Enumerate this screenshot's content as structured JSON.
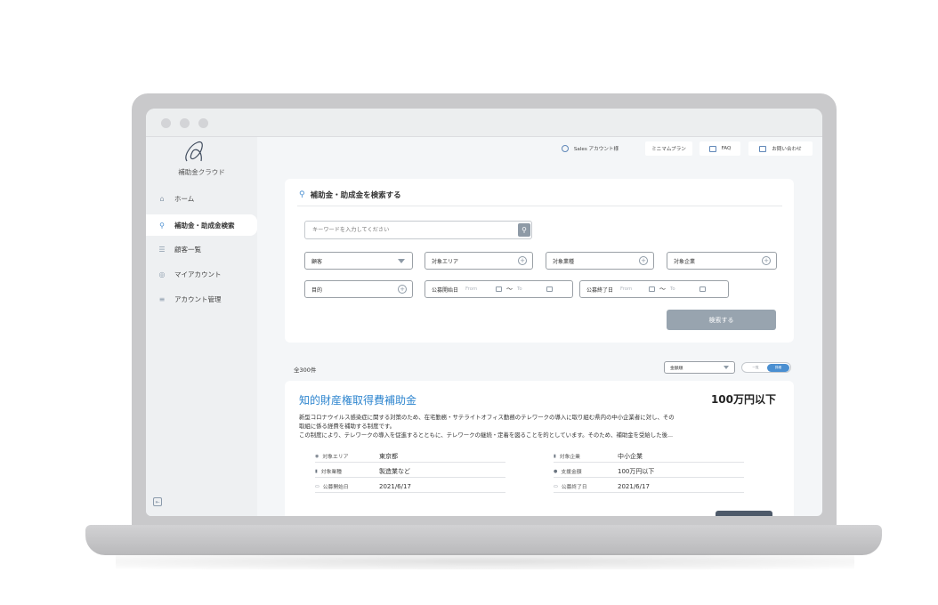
{
  "app": {
    "logo_text": "補助金クラウド"
  },
  "sidebar": {
    "items": [
      {
        "label": "ホーム",
        "icon": "home-icon"
      },
      {
        "label": "補助金・助成金検索",
        "icon": "search-icon",
        "active": true
      },
      {
        "label": "顧客一覧",
        "icon": "user-list-icon"
      },
      {
        "label": "マイアカウント",
        "icon": "user-circle-icon"
      },
      {
        "label": "アカウント管理",
        "icon": "settings-list-icon"
      }
    ]
  },
  "header": {
    "user_label": "Sales アカウント様",
    "plan_label": "ミニマムプラン",
    "faq_label": "FAQ",
    "contact_label": "お問い合わせ"
  },
  "search": {
    "title": "補助金・助成金を検索する",
    "keyword_placeholder": "キーワードを入力してください",
    "customer_label": "顧客",
    "area_label": "対象エリア",
    "industry_label": "対象業種",
    "company_label": "対象企業",
    "purpose_label": "目的",
    "start_date_label": "公募開始日",
    "end_date_label": "公募終了日",
    "from_placeholder": "From",
    "to_placeholder": "To",
    "tilde": "〜",
    "submit_label": "検索する"
  },
  "results": {
    "count_label": "全300件",
    "sort_label": "金額順",
    "view_list_label": "一覧",
    "view_detail_label": "詳細",
    "items": [
      {
        "title": "知的財産権取得費補助金",
        "amount": "100万円以下",
        "description": [
          "新型コロナウイルス感染症に関する対策のため、在宅勤務・サテライトオフィス勤務のテレワークの導入に取り組む県内の中小企業者に対し、その",
          "取組に係る経費を補助する制度です。",
          "この制度により、テレワークの導入を促進するとともに、テレワークの継続・定着を図ることを的としています。そのため、補助金を受給した後..."
        ],
        "attributes": {
          "area_label": "対象エリア",
          "area": "東京都",
          "industry_label": "対象業種",
          "industry": "製造業など",
          "start_label": "公募開始日",
          "start": "2021/6/17",
          "company_label": "対象企業",
          "company": "中小企業",
          "support_label": "支援金額",
          "support": "100万円以下",
          "end_label": "公募終了日",
          "end": "2021/6/17"
        }
      }
    ]
  },
  "colors": {
    "accent": "#2f86cf",
    "button": "#98a4af",
    "sidebar_bg": "#eef0f2"
  }
}
